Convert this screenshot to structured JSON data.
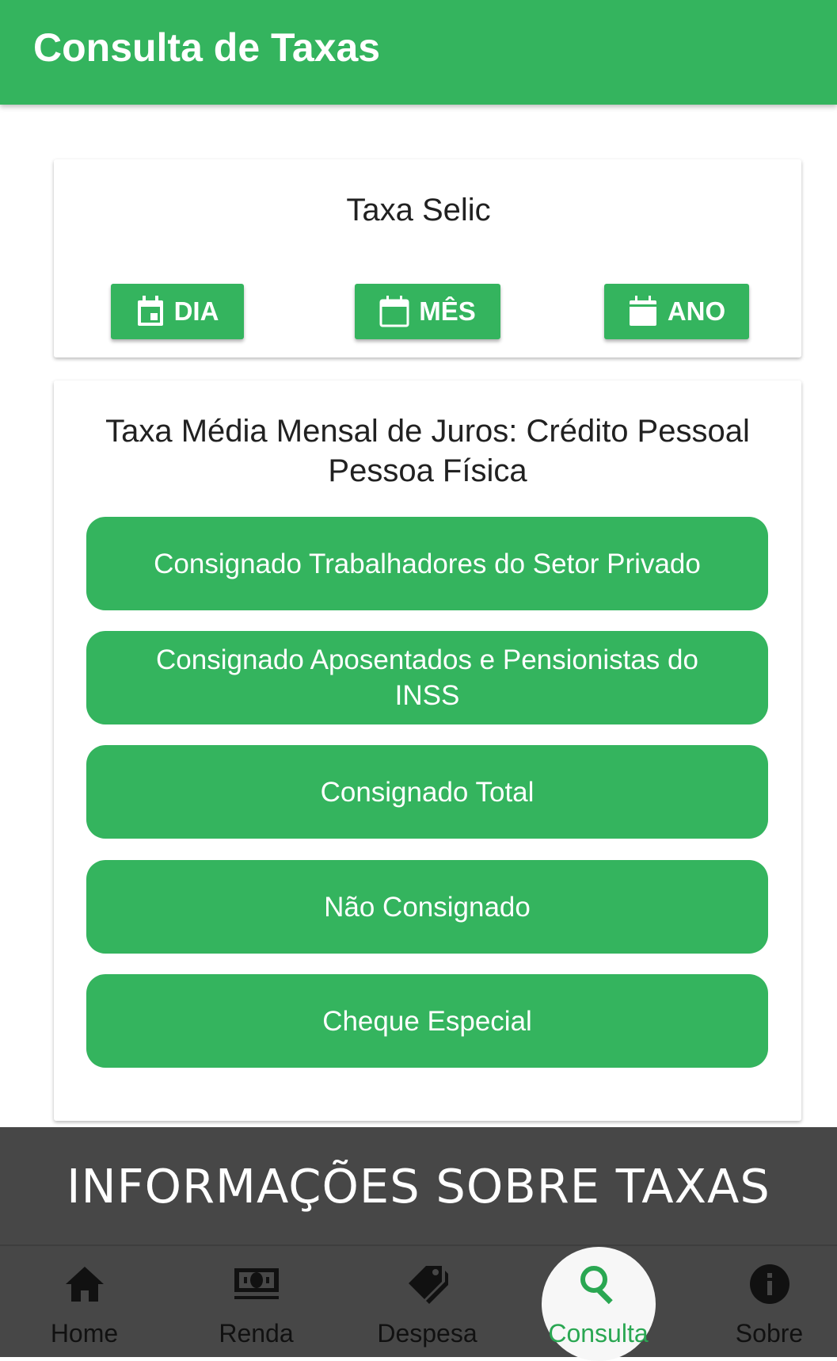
{
  "header": {
    "title": "Consulta de Taxas"
  },
  "selic": {
    "title": "Taxa Selic",
    "buttons": [
      {
        "label": "DIA",
        "icon": "calendar-today-icon"
      },
      {
        "label": "MÊS",
        "icon": "calendar-blank-icon"
      },
      {
        "label": "ANO",
        "icon": "calendar-icon"
      }
    ]
  },
  "juros": {
    "title": "Taxa Média Mensal de Juros: Crédito Pessoal Pessoa Física",
    "options": [
      "Consignado Trabalhadores do Setor Privado",
      "Consignado Aposentados e Pensionistas do INSS",
      "Consignado Total",
      "Não Consignado",
      "Cheque Especial"
    ]
  },
  "banner": {
    "text": "INFORMAÇÕES SOBRE TAXAS"
  },
  "nav": {
    "items": [
      {
        "label": "Home",
        "icon": "home-icon"
      },
      {
        "label": "Renda",
        "icon": "money-icon"
      },
      {
        "label": "Despesa",
        "icon": "tag-icon"
      },
      {
        "label": "Consulta",
        "icon": "search-icon"
      },
      {
        "label": "Sobre",
        "icon": "info-icon"
      }
    ],
    "active": "Consulta"
  },
  "colors": {
    "primary": "#34b45e",
    "dark_bar": "#474747",
    "active_label": "#2aa752"
  }
}
